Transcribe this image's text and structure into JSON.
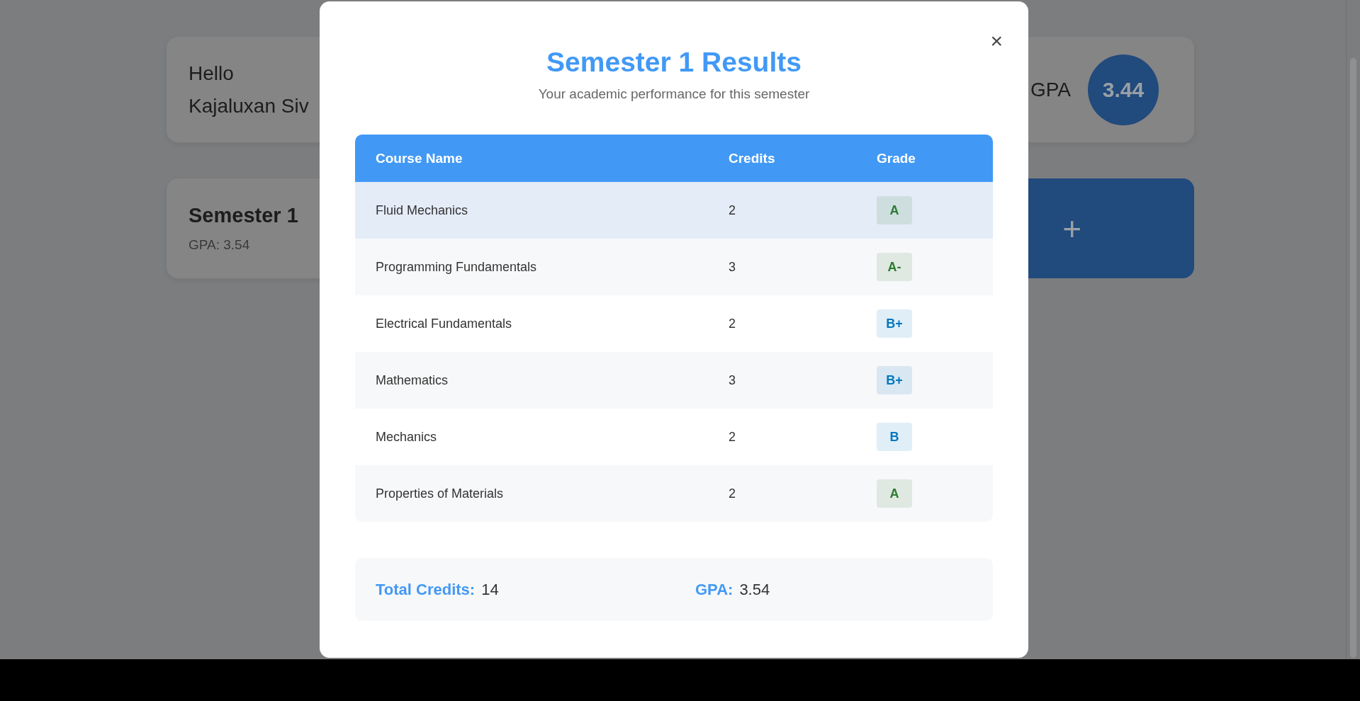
{
  "background": {
    "greeting": "Hello",
    "name": "Kajaluxan Siv",
    "cgpa_label": "GPA",
    "cgpa": "3.44",
    "semester_card": {
      "title": "Semester 1",
      "gpa": "GPA: 3.54"
    },
    "add_button": "+"
  },
  "modal": {
    "title": "Semester 1 Results",
    "subtitle": "Your academic performance for this semester",
    "close": "×",
    "columns": [
      "Course Name",
      "Credits",
      "Grade"
    ],
    "rows": [
      {
        "course": "Fluid Mechanics",
        "credits": "2",
        "grade": "A",
        "color": "#2e7d32",
        "hovered": true
      },
      {
        "course": "Programming Fundamentals",
        "credits": "3",
        "grade": "A-",
        "color": "#2e7d32",
        "hovered": false
      },
      {
        "course": "Electrical Fundamentals",
        "credits": "2",
        "grade": "B+",
        "color": "#0277bd",
        "hovered": false
      },
      {
        "course": "Mathematics",
        "credits": "3",
        "grade": "B+",
        "color": "#0277bd",
        "hovered": false
      },
      {
        "course": "Mechanics",
        "credits": "2",
        "grade": "B",
        "color": "#0277bd",
        "hovered": false
      },
      {
        "course": "Properties of Materials",
        "credits": "2",
        "grade": "A",
        "color": "#2e7d32",
        "hovered": false
      }
    ],
    "summary": [
      {
        "label": "Total Credits:",
        "value": "14"
      },
      {
        "label": "GPA:",
        "value": "3.54"
      }
    ]
  }
}
